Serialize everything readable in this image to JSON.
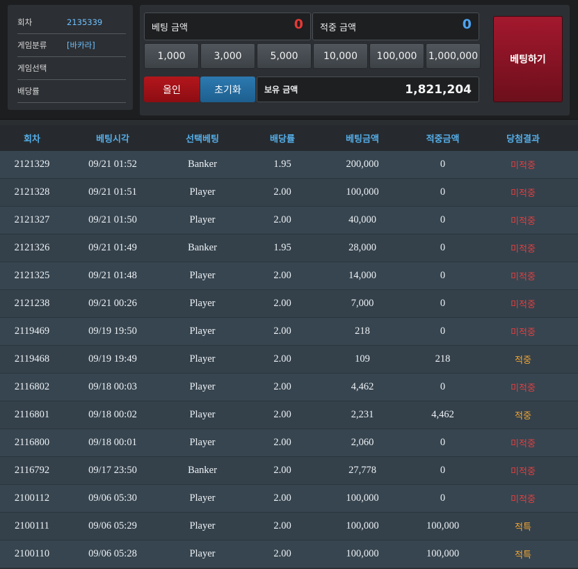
{
  "info": {
    "round_label": "회차",
    "round_value": "2135339",
    "category_label": "게임분류",
    "category_value": "[바카라]",
    "select_label": "게임선택",
    "odds_label": "배당률"
  },
  "bet": {
    "bet_amount_label": "베팅 금액",
    "bet_amount_value": "0",
    "win_amount_label": "적중 금액",
    "win_amount_value": "0",
    "chips": [
      "1,000",
      "3,000",
      "5,000",
      "10,000",
      "100,000",
      "1,000,000"
    ],
    "allin_label": "올인",
    "reset_label": "초기화",
    "holding_label": "보유 금액",
    "holding_value": "1,821,204",
    "bet_button_label": "베팅하기"
  },
  "table": {
    "headers": [
      "회차",
      "베팅시각",
      "선택베팅",
      "배당률",
      "베팅금액",
      "적중금액",
      "당첨결과"
    ],
    "rows": [
      {
        "round": "2121329",
        "time": "09/21 01:52",
        "pick": "Banker",
        "odds": "1.95",
        "bet": "200,000",
        "win": "0",
        "result": "미적중",
        "won": false
      },
      {
        "round": "2121328",
        "time": "09/21 01:51",
        "pick": "Player",
        "odds": "2.00",
        "bet": "100,000",
        "win": "0",
        "result": "미적중",
        "won": false
      },
      {
        "round": "2121327",
        "time": "09/21 01:50",
        "pick": "Player",
        "odds": "2.00",
        "bet": "40,000",
        "win": "0",
        "result": "미적중",
        "won": false
      },
      {
        "round": "2121326",
        "time": "09/21 01:49",
        "pick": "Banker",
        "odds": "1.95",
        "bet": "28,000",
        "win": "0",
        "result": "미적중",
        "won": false
      },
      {
        "round": "2121325",
        "time": "09/21 01:48",
        "pick": "Player",
        "odds": "2.00",
        "bet": "14,000",
        "win": "0",
        "result": "미적중",
        "won": false
      },
      {
        "round": "2121238",
        "time": "09/21 00:26",
        "pick": "Player",
        "odds": "2.00",
        "bet": "7,000",
        "win": "0",
        "result": "미적중",
        "won": false
      },
      {
        "round": "2119469",
        "time": "09/19 19:50",
        "pick": "Player",
        "odds": "2.00",
        "bet": "218",
        "win": "0",
        "result": "미적중",
        "won": false
      },
      {
        "round": "2119468",
        "time": "09/19 19:49",
        "pick": "Player",
        "odds": "2.00",
        "bet": "109",
        "win": "218",
        "result": "적중",
        "won": true
      },
      {
        "round": "2116802",
        "time": "09/18 00:03",
        "pick": "Player",
        "odds": "2.00",
        "bet": "4,462",
        "win": "0",
        "result": "미적중",
        "won": false
      },
      {
        "round": "2116801",
        "time": "09/18 00:02",
        "pick": "Player",
        "odds": "2.00",
        "bet": "2,231",
        "win": "4,462",
        "result": "적중",
        "won": true
      },
      {
        "round": "2116800",
        "time": "09/18 00:01",
        "pick": "Player",
        "odds": "2.00",
        "bet": "2,060",
        "win": "0",
        "result": "미적중",
        "won": false
      },
      {
        "round": "2116792",
        "time": "09/17 23:50",
        "pick": "Banker",
        "odds": "2.00",
        "bet": "27,778",
        "win": "0",
        "result": "미적중",
        "won": false
      },
      {
        "round": "2100112",
        "time": "09/06 05:30",
        "pick": "Player",
        "odds": "2.00",
        "bet": "100,000",
        "win": "0",
        "result": "미적중",
        "won": false
      },
      {
        "round": "2100111",
        "time": "09/06 05:29",
        "pick": "Player",
        "odds": "2.00",
        "bet": "100,000",
        "win": "100,000",
        "result": "적특",
        "won": true
      },
      {
        "round": "2100110",
        "time": "09/06 05:28",
        "pick": "Player",
        "odds": "2.00",
        "bet": "100,000",
        "win": "100,000",
        "result": "적특",
        "won": true
      }
    ]
  },
  "colors": {
    "lose": "#e43f3f",
    "win": "#f0a431",
    "header_text": "#55aee9",
    "bet_red": "#e53935",
    "win_blue": "#4ea3f0"
  }
}
